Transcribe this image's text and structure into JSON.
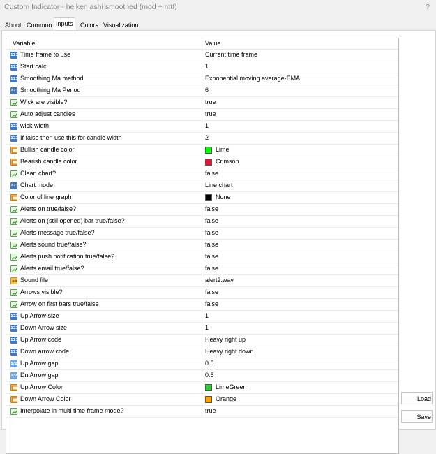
{
  "window": {
    "title": "Custom Indicator - heiken ashi smoothed (mod + mtf)",
    "help": "?"
  },
  "tabs": [
    {
      "label": "About",
      "active": false
    },
    {
      "label": "Common",
      "active": false
    },
    {
      "label": "Inputs",
      "active": true
    },
    {
      "label": "Colors",
      "active": false
    },
    {
      "label": "Visualization",
      "active": false
    }
  ],
  "grid": {
    "headers": {
      "variable": "Variable",
      "value": "Value"
    },
    "rows": [
      {
        "icon": "int-icon",
        "name": "Time frame to use",
        "value": "Current time frame"
      },
      {
        "icon": "int-icon",
        "name": "Start calc",
        "value": "1"
      },
      {
        "icon": "int-icon",
        "name": "Smoothing Ma method",
        "value": "Exponential moving average-EMA"
      },
      {
        "icon": "int-icon",
        "name": "Smoothing Ma Period",
        "value": "6"
      },
      {
        "icon": "bool-icon",
        "name": "Wick are visible?",
        "value": "true"
      },
      {
        "icon": "bool-icon",
        "name": "Auto adjust candles",
        "value": "true"
      },
      {
        "icon": "int-icon",
        "name": "wick width",
        "value": "1"
      },
      {
        "icon": "int-icon",
        "name": "If  false then use this for candle width",
        "value": "2"
      },
      {
        "icon": "color-icon",
        "name": "Bullish candle  color",
        "value": "Lime",
        "swatch": "#00ff00"
      },
      {
        "icon": "color-icon",
        "name": "Bearish candle  color",
        "value": "Crimson",
        "swatch": "#dc143c"
      },
      {
        "icon": "bool-icon",
        "name": "Clean chart?",
        "value": "false"
      },
      {
        "icon": "int-icon",
        "name": "Chart mode",
        "value": "Line chart"
      },
      {
        "icon": "color-icon",
        "name": "Color of line graph",
        "value": "None",
        "swatch": "#000000"
      },
      {
        "icon": "bool-icon",
        "name": "Alerts on true/false?",
        "value": "false"
      },
      {
        "icon": "bool-icon",
        "name": "Alerts on (still opened) bar true/false?",
        "value": "false"
      },
      {
        "icon": "bool-icon",
        "name": "Alerts message true/false?",
        "value": "false"
      },
      {
        "icon": "bool-icon",
        "name": "Alerts sound true/false?",
        "value": "false"
      },
      {
        "icon": "bool-icon",
        "name": "Alerts push notification true/false?",
        "value": "false"
      },
      {
        "icon": "bool-icon",
        "name": "Alerts email true/false?",
        "value": "false"
      },
      {
        "icon": "string-icon",
        "name": "Sound file",
        "value": "alert2.wav"
      },
      {
        "icon": "bool-icon",
        "name": "Arrows visible?",
        "value": "false"
      },
      {
        "icon": "bool-icon",
        "name": "Arrow on first bars true/false",
        "value": "false"
      },
      {
        "icon": "int-icon",
        "name": "Up Arrow size",
        "value": "1"
      },
      {
        "icon": "int-icon",
        "name": "Down Arrow size",
        "value": "1"
      },
      {
        "icon": "int-icon",
        "name": "Up Arrow code",
        "value": "Heavy right up"
      },
      {
        "icon": "int-icon",
        "name": "Down arrow code",
        "value": "Heavy right down"
      },
      {
        "icon": "double-icon",
        "name": "Up Arrow gap",
        "value": "0.5"
      },
      {
        "icon": "double-icon",
        "name": "Dn Arrow gap",
        "value": "0.5"
      },
      {
        "icon": "color-icon",
        "name": "Up Arrow Color",
        "value": "LimeGreen",
        "swatch": "#32cd32"
      },
      {
        "icon": "color-icon",
        "name": "Down Arrow Color",
        "value": "Orange",
        "swatch": "#ffa500"
      },
      {
        "icon": "bool-icon",
        "name": "Interpolate in multi time frame mode?",
        "value": "true"
      }
    ]
  },
  "buttons": {
    "load": "Load",
    "save": "Save"
  },
  "icon_glyphs": {
    "int-icon": "123",
    "double-icon": "1/2",
    "string-icon": "ab"
  }
}
